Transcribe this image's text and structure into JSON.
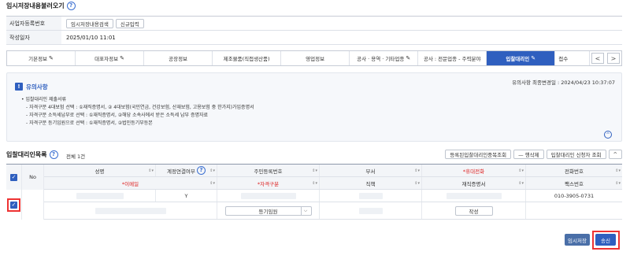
{
  "page": {
    "title": "임시저장내용불러오기"
  },
  "info": {
    "biz_label": "사업자등록번호",
    "btn_search": "임시저장내용검색",
    "btn_new": "신규입력",
    "date_label": "작성일자",
    "date_value": "2025/01/10 11:01"
  },
  "tabs": [
    {
      "label": "기본정보",
      "pen": true
    },
    {
      "label": "대표자정보",
      "pen": true
    },
    {
      "label": "공장정보",
      "pen": false
    },
    {
      "label": "제조물품(직접생산품)",
      "pen": false
    },
    {
      "label": "영업정보",
      "pen": false
    },
    {
      "label": "공사 · 용역 · 기타업종",
      "pen": true
    },
    {
      "label": "공사 : 전문업종 - 주력분야",
      "pen": false
    },
    {
      "label": "입찰대리인",
      "pen": true,
      "active": true
    },
    {
      "label": "접수",
      "pen": false
    }
  ],
  "tab_nav": {
    "prev": "<",
    "next": ">"
  },
  "notice": {
    "badge": "!",
    "title": "유의사항",
    "updated": "유의사항 최종변경일 : 2024/04/23 10:37:07",
    "lines": [
      "• 입찰대리인 제출서류",
      "- 자격구분 4대보험 선택 : ①재직증명서, ② 4대보험(국민연금, 건강보험, 산재보험, 고용보험 중 한가지)가입증명서",
      "- 자격구분 소득세납부로 선택 : ①재직증명서, ②해당 소속사에서 받은 소득세 납부 증명자료",
      "- 자격구분 등기임원으로 선택 : ①재직증명서, ②법인등기부등본"
    ],
    "collapse": "^"
  },
  "list": {
    "title": "입찰대리인목록",
    "count": "전체 1건",
    "btn_dup": "등록된입찰대리인중복조회",
    "btn_delrow": "— 행삭제",
    "btn_status": "입찰대리인 신청자 조회",
    "btn_fold": "^"
  },
  "grid": {
    "head1": [
      "성명",
      "계정연결여부",
      "주민등록번호",
      "부서",
      "*휴대전화",
      "전화번호"
    ],
    "head2": [
      "*이메일",
      "*자격구분",
      "직책",
      "재직증명서",
      "팩스번호"
    ],
    "no_label": "No",
    "row": {
      "account_link": "Y",
      "qualification": "등기임원",
      "attach_btn": "작성",
      "phone": "010-3905-0731"
    }
  },
  "actions": {
    "save": "임시저장",
    "send": "송신"
  },
  "colors": {
    "accent": "#2f5fbf",
    "highlight": "#e33333"
  }
}
